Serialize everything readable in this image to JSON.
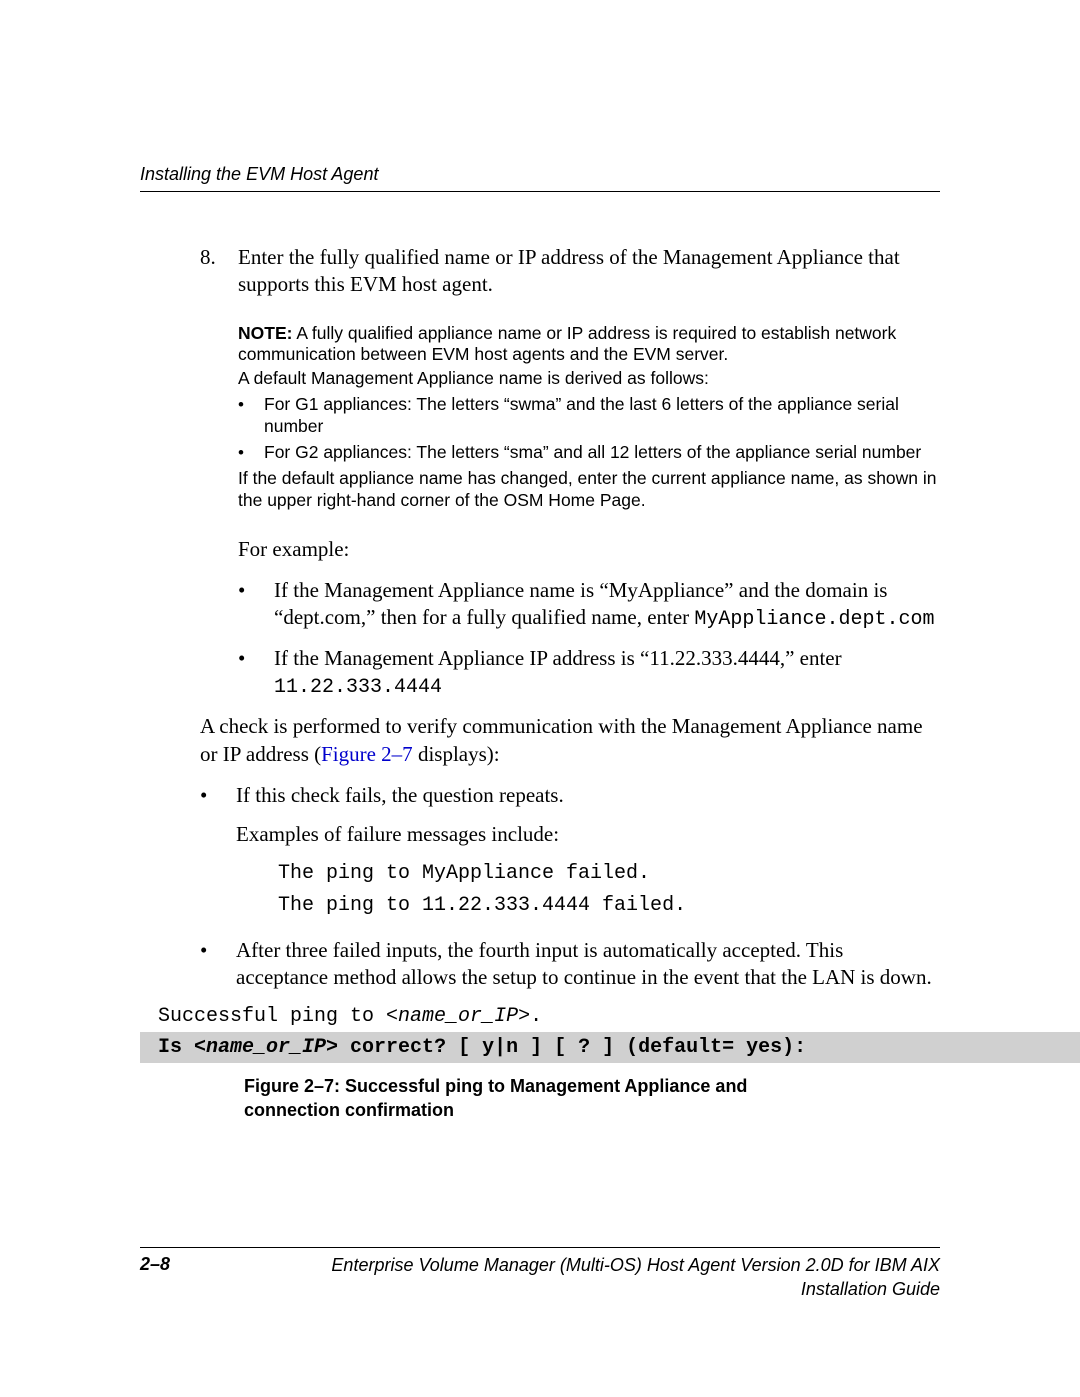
{
  "header": {
    "running": "Installing the EVM Host Agent"
  },
  "step": {
    "number": "8.",
    "text": "Enter the fully qualified name or IP address of the Management Appliance that supports this EVM host agent."
  },
  "note": {
    "label": "NOTE:",
    "line1": "A fully qualified appliance name or IP address is required to establish network communication between EVM host agents and the EVM server.",
    "line2": "A default Management Appliance name is derived as follows:",
    "b1": "For G1 appliances: The letters “swma” and the last 6 letters of the appliance serial number",
    "b2": "For G2 appliances: The letters “sma” and all 12 letters of the appliance serial number",
    "line3": "If the default appliance name has changed, enter the current appliance name, as shown in the upper right-hand corner of the OSM Home Page."
  },
  "example": {
    "intro": "For example:",
    "b1_text": "If the Management Appliance name is “MyAppliance” and the domain is “dept.com,” then for a fully qualified name, enter ",
    "b1_code": "MyAppliance.dept.com",
    "b2_text": "If the Management Appliance IP address is “11.22.333.4444,” enter ",
    "b2_code": "11.22.333.4444"
  },
  "check": {
    "para_pre": "A check is performed to verify communication with the Management Appliance name or IP address (",
    "link": "Figure 2–7",
    "para_post": " displays):",
    "b1": "If this check fails, the question repeats.",
    "b1_sub": "Examples of failure messages include:",
    "code1": "The ping to MyAppliance failed.",
    "code2": "The ping to 11.22.333.4444 failed.",
    "b2": "After three failed inputs, the fourth input is automatically accepted. This acceptance method allows the setup to continue in the event that the LAN is down."
  },
  "figure": {
    "line1_pre": "Successful ping to ",
    "line1_var": "<name_or_IP>",
    "line1_post": ".",
    "line2_pre": "Is ",
    "line2_var": "<name_or_IP>",
    "line2_post": " correct? [ y|n ] [ ? ] (default= yes):",
    "caption": "Figure 2–7:  Successful ping to Management Appliance and connection confirmation"
  },
  "footer": {
    "page": "2–8",
    "title": "Enterprise Volume Manager (Multi-OS) Host Agent Version 2.0D for IBM AIX Installation Guide"
  }
}
